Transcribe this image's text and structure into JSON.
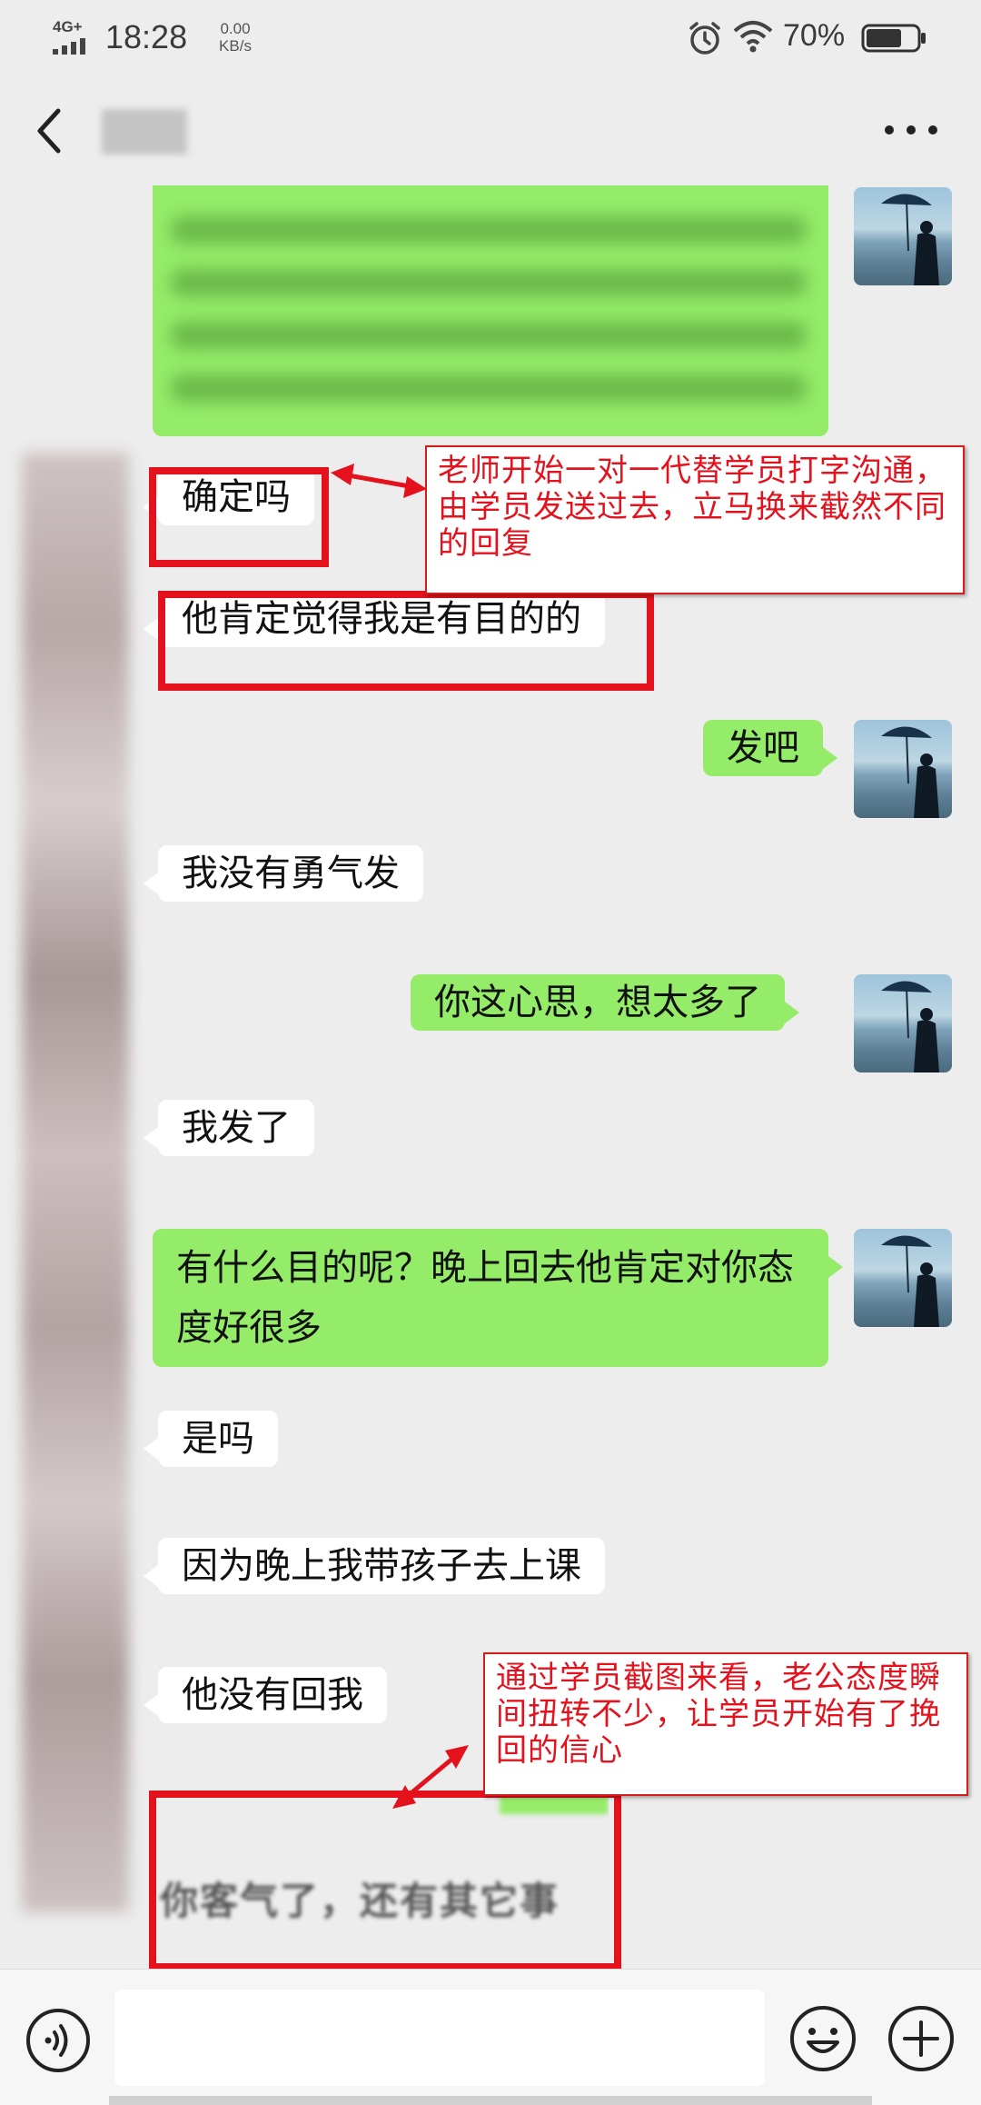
{
  "status_bar": {
    "network": "4G+",
    "time": "18:28",
    "speed_value": "0.00",
    "speed_unit": "KB/s",
    "battery": "70%",
    "battery_level": 0.7
  },
  "title_bar": {
    "contact_name": "",
    "back_icon": "chevron-left-icon",
    "more_icon": "more-dots-icon"
  },
  "messages": [
    {
      "side": "out",
      "text": ""
    },
    {
      "side": "in",
      "text": "确定吗"
    },
    {
      "side": "in",
      "text": "他肯定觉得我是有目的的"
    },
    {
      "side": "out",
      "text": "发吧"
    },
    {
      "side": "in",
      "text": "我没有勇气发"
    },
    {
      "side": "out",
      "text": "你这心思，想太多了"
    },
    {
      "side": "in",
      "text": "我发了"
    },
    {
      "side": "out",
      "text": "有什么目的呢？晚上回去他肯定对你态度好很多"
    },
    {
      "side": "in",
      "text": "是吗"
    },
    {
      "side": "in",
      "text": "因为晚上我带孩子去上课"
    },
    {
      "side": "in",
      "text": "他没有回我"
    },
    {
      "side": "in",
      "text": "你客气了，还有其它事"
    }
  ],
  "annotations": {
    "top": "老师开始一对一代替学员打字沟通，由学员发送过去，立马换来截然不同的回复",
    "bottom": "通过学员截图来看，老公态度瞬间扭转不少，让学员开始有了挽回的信心"
  },
  "input_bar": {
    "voice_icon": "voice-icon",
    "emoji_icon": "emoji-icon",
    "add_icon": "plus-icon",
    "input_value": ""
  },
  "colors": {
    "outgoing_bubble": "#95ec69",
    "incoming_bubble": "#ffffff",
    "background": "#ededed",
    "annotation_red": "#e3121d"
  }
}
